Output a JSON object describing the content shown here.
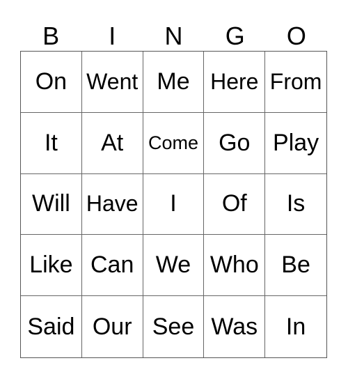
{
  "header": [
    "B",
    "I",
    "N",
    "G",
    "O"
  ],
  "grid": [
    [
      "On",
      "Went",
      "Me",
      "Here",
      "From"
    ],
    [
      "It",
      "At",
      "Come",
      "Go",
      "Play"
    ],
    [
      "Will",
      "Have",
      "I",
      "Of",
      "Is"
    ],
    [
      "Like",
      "Can",
      "We",
      "Who",
      "Be"
    ],
    [
      "Said",
      "Our",
      "See",
      "Was",
      "In"
    ]
  ]
}
